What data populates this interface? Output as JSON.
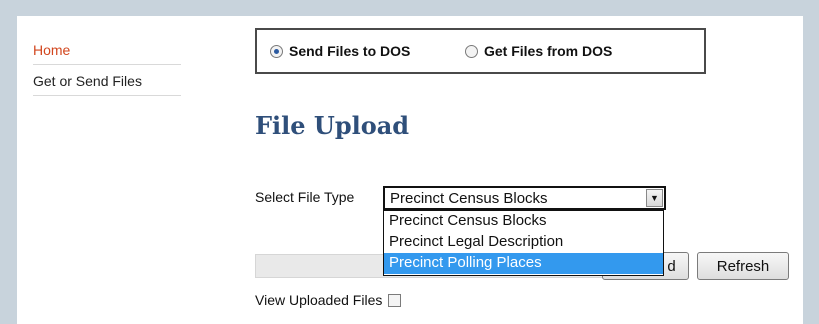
{
  "nav": {
    "home": "Home",
    "get_or_send": "Get or Send Files"
  },
  "radio_group": {
    "send_label": "Send Files to DOS",
    "get_label": "Get Files from DOS",
    "selected": "send"
  },
  "page_title": "File Upload",
  "file_type": {
    "label": "Select File Type",
    "selected_value": "Precinct Census Blocks",
    "options": [
      "Precinct Census Blocks",
      "Precinct Legal Description",
      "Precinct Polling Places"
    ],
    "highlighted_index": 2
  },
  "buttons": {
    "upload_partial_label": "d",
    "refresh_label": "Refresh"
  },
  "view_uploaded": {
    "label": "View Uploaded Files",
    "checked": false
  },
  "colors": {
    "nav_active": "#d2461e",
    "title": "#2f4f7a",
    "highlight": "#3399ee",
    "frame_bg": "#c8d3dc"
  }
}
